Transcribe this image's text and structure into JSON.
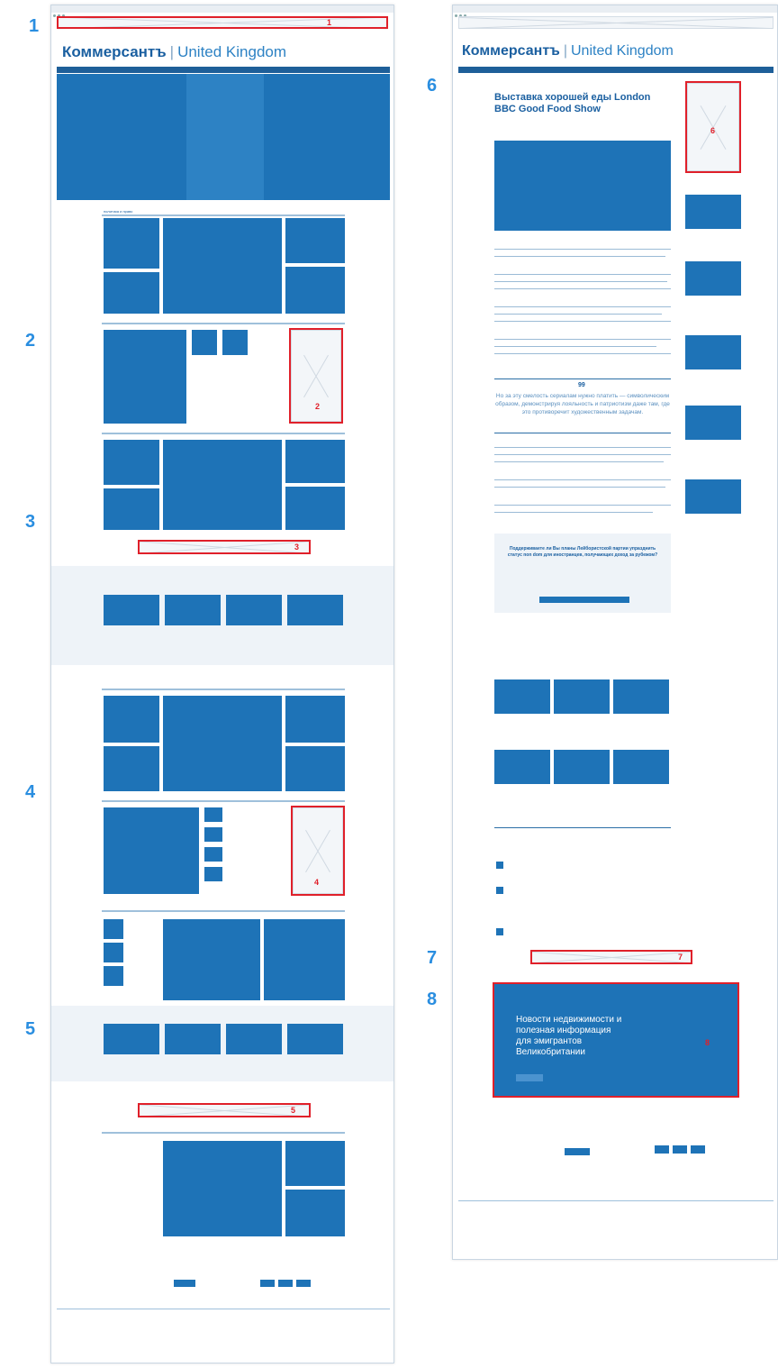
{
  "markers": [
    "1",
    "2",
    "3",
    "4",
    "5",
    "6",
    "7",
    "8"
  ],
  "left": {
    "header": {
      "brand": "Коммерсантъ",
      "region": "United Kingdom"
    },
    "ad_label": "Баннер",
    "ad_numbers": [
      "1",
      "2",
      "3",
      "4",
      "5"
    ]
  },
  "right": {
    "header": {
      "brand": "Коммерсантъ",
      "region": "United Kingdom"
    },
    "article_title": "Выставка хорошей еды London BBC Good Food Show",
    "quote": "Но за эту смелость сериалам нужно платить — символическим образом, демонстрируя лояльность и патриотизм даже там, где это противоречит художественным задачам.",
    "quote_mark": "99",
    "poll_title": "Поддерживаете ли Вы планы Лейбористской партии упразднить статус non dom для иностранцев, получающих доход за рубежом?",
    "cta_title": "Новости недвижимости и полезная информация для эмигрантов Великобритании",
    "ad_numbers": [
      "6",
      "7",
      "8"
    ]
  },
  "colors": {
    "accent": "#1e73b7",
    "marker": "#2a8ee0",
    "highlight": "#e0202a"
  }
}
